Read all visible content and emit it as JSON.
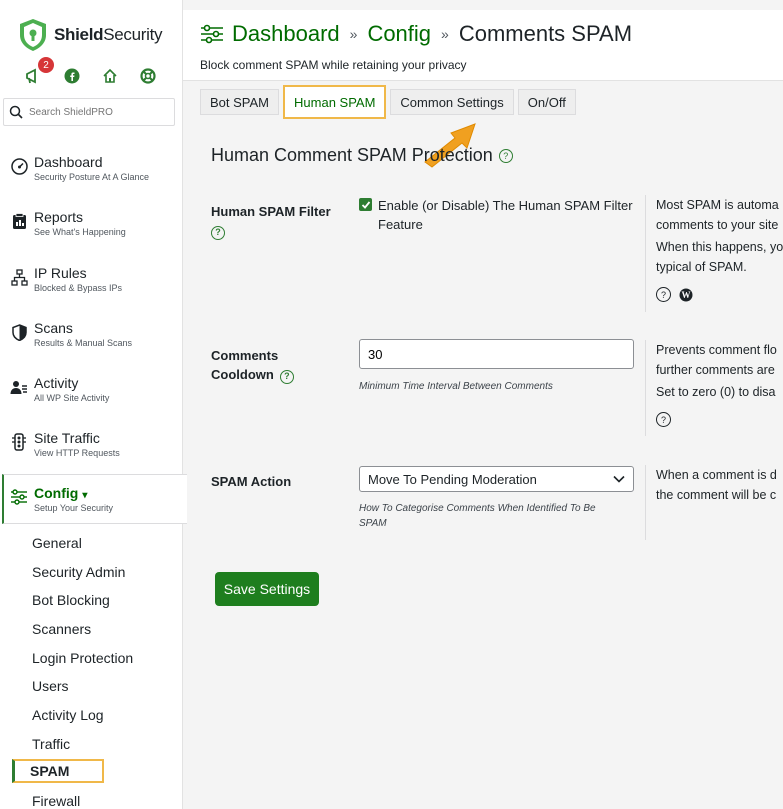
{
  "brand": {
    "name_bold": "Shield",
    "name_rest": "Security"
  },
  "notifications": {
    "count": "2"
  },
  "search": {
    "placeholder": "Search ShieldPRO"
  },
  "nav": [
    {
      "title": "Dashboard",
      "subtitle": "Security Posture At A Glance",
      "icon": "gauge-icon"
    },
    {
      "title": "Reports",
      "subtitle": "See What's Happening",
      "icon": "report-icon"
    },
    {
      "title": "IP Rules",
      "subtitle": "Blocked & Bypass IPs",
      "icon": "network-icon"
    },
    {
      "title": "Scans",
      "subtitle": "Results & Manual Scans",
      "icon": "shield-icon"
    },
    {
      "title": "Activity",
      "subtitle": "All WP Site Activity",
      "icon": "users-icon"
    },
    {
      "title": "Site Traffic",
      "subtitle": "View HTTP Requests",
      "icon": "traffic-light-icon"
    },
    {
      "title": "Config",
      "subtitle": "Setup Your Security",
      "icon": "sliders-icon",
      "caret": "▾"
    }
  ],
  "submenu": [
    "General",
    "Security Admin",
    "Bot Blocking",
    "Scanners",
    "Login Protection",
    "Users",
    "Activity Log",
    "Traffic",
    "SPAM",
    "Firewall"
  ],
  "breadcrumb": {
    "item1": "Dashboard",
    "sep": "»",
    "item2": "Config",
    "current": "Comments SPAM"
  },
  "page_subtitle": "Block comment SPAM while retaining your privacy",
  "tabs": [
    "Bot SPAM",
    "Human SPAM",
    "Common Settings",
    "On/Off"
  ],
  "section_title": "Human Comment SPAM Protection",
  "rows": {
    "filter": {
      "label": "Human SPAM Filter",
      "checkbox_label": "Enable (or Disable) The Human SPAM Filter Feature",
      "desc1": "Most SPAM is automa",
      "desc2": "comments to your site",
      "desc3": "When this happens, yo",
      "desc4": "typical of SPAM."
    },
    "cooldown": {
      "label1": "Comments",
      "label2": "Cooldown",
      "value": "30",
      "hint": "Minimum Time Interval Between Comments",
      "desc1": "Prevents comment flo",
      "desc2": "further comments are",
      "desc3": "Set to zero (0) to disa"
    },
    "action": {
      "label": "SPAM Action",
      "value": "Move To Pending Moderation",
      "hint": "How To Categorise Comments When Identified To Be SPAM",
      "desc1": "When a comment is d",
      "desc2": "the comment will be c"
    }
  },
  "save_button": "Save Settings",
  "colors": {
    "brand_green": "#006b00",
    "highlight": "#f0b849",
    "button": "#1e7e1e"
  }
}
